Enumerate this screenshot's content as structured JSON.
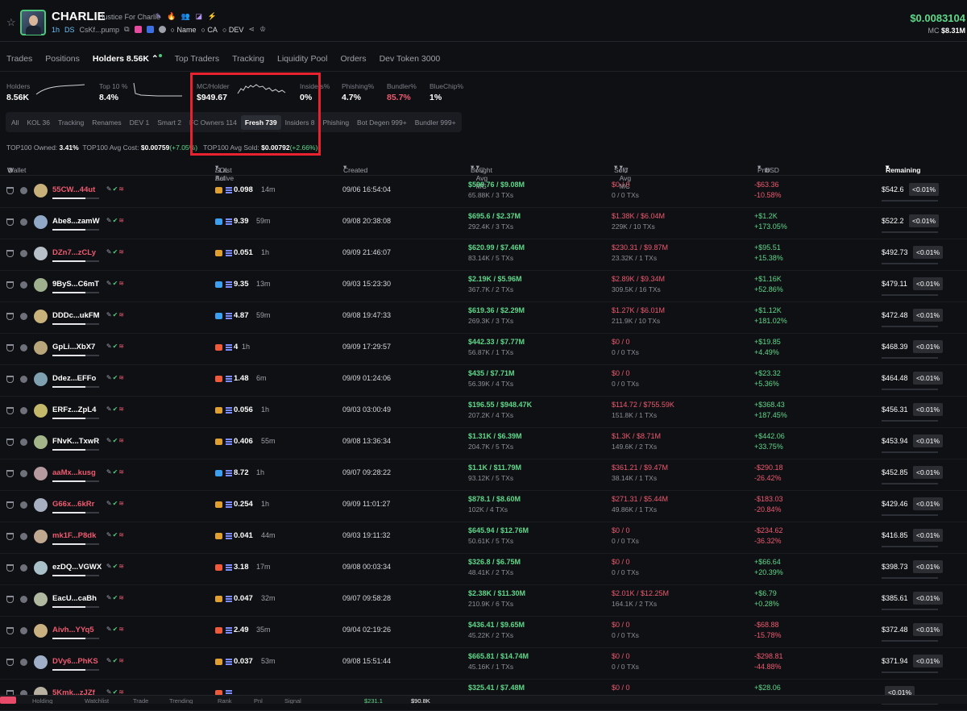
{
  "header": {
    "token_name": "CHARLIE",
    "token_subtitle": "Justice For Charlie",
    "age": "1h",
    "ds": "DS",
    "address": "CsKf...pump",
    "name_label": "Name",
    "ca_label": "CA",
    "dev_label": "DEV",
    "price": "$0.0083104",
    "mc_label": "MC",
    "mc_value": "$8.31M"
  },
  "tabs": [
    "Trades",
    "Positions",
    "Holders 8.56K",
    "Top Traders",
    "Tracking",
    "Liquidity Pool",
    "Orders",
    "Dev Token 3000"
  ],
  "stats": [
    {
      "label": "Holders",
      "value": "8.56K"
    },
    {
      "label": "Top 10 %",
      "value": "8.4%"
    },
    {
      "label": "MC/Holder",
      "value": "$949.67"
    },
    {
      "label": "Insiders%",
      "value": "0%"
    },
    {
      "label": "Phishing%",
      "value": "4.7%"
    },
    {
      "label": "Bundler%",
      "value": "85.7%"
    },
    {
      "label": "BlueChip%",
      "value": "1%"
    }
  ],
  "filters": [
    "All",
    "KOL 36",
    "Tracking",
    "Renames",
    "DEV 1",
    "Smart 2",
    "FC Owners 114",
    "Fresh 739",
    "Insiders 8",
    "Phishing",
    "Bot Degen 999+",
    "Bundler 999+"
  ],
  "top100": {
    "owned_label": "TOP100 Owned:",
    "owned_value": "3.41%",
    "avgcost_label": "TOP100 Avg Cost:",
    "avgcost_value": "$0.00759",
    "avgcost_change": "(+7.05%)",
    "avgsold_label": "TOP100 Avg Sold:",
    "avgsold_value": "$0.00792",
    "avgsold_change": "(+2.66%)"
  },
  "columns": {
    "wallet": "Wallet",
    "sol": "SOL Bal",
    "last_active": "/ Last Active",
    "created": "Created",
    "bought": "Bought",
    "avg_mc_bought": "/ Avg MC",
    "sold": "Sold",
    "avg_mc_sold": "/ Avg MC",
    "pnl": "Pnl",
    "usd": "USD",
    "remaining": "Remaining"
  },
  "rows": [
    {
      "wallet": "55CW...44ut",
      "wcolor": "red",
      "sol": "0.098",
      "active": "14m",
      "solicon": "pump",
      "created": "09/06 16:54:04",
      "bought": "$598.76 / $9.08M",
      "bought_sub": "65.88K / 3 TXs",
      "sold": "$0 / 0",
      "sold_sub": "0 / 0 TXs",
      "pnl": "-$63.36",
      "pnl_pct": "-10.58%",
      "pnl_color": "red",
      "remaining": "$542.6",
      "pct": "<0.01%"
    },
    {
      "wallet": "Abe8...zamW",
      "wcolor": "white",
      "sol": "9.39",
      "active": "59m",
      "solicon": "fish",
      "created": "09/08 20:38:08",
      "bought": "$695.6 / $2.37M",
      "bought_sub": "292.4K / 3 TXs",
      "sold": "$1.38K / $6.04M",
      "sold_sub": "229K / 10 TXs",
      "pnl": "+$1.2K",
      "pnl_pct": "+173.05%",
      "pnl_color": "green",
      "remaining": "$522.2",
      "pct": "<0.01%"
    },
    {
      "wallet": "DZn7...zCLy",
      "wcolor": "red",
      "sol": "0.051",
      "active": "1h",
      "solicon": "pump",
      "created": "09/09 21:46:07",
      "bought": "$620.99 / $7.46M",
      "bought_sub": "83.14K / 5 TXs",
      "sold": "$230.31 / $9.87M",
      "sold_sub": "23.32K / 1 TXs",
      "pnl": "+$95.51",
      "pnl_pct": "+15.38%",
      "pnl_color": "green",
      "remaining": "$492.73",
      "pct": "<0.01%"
    },
    {
      "wallet": "9ByS...C6mT",
      "wcolor": "white",
      "sol": "9.35",
      "active": "13m",
      "solicon": "fish",
      "created": "09/03 15:23:30",
      "bought": "$2.19K / $5.96M",
      "bought_sub": "367.7K / 2 TXs",
      "sold": "$2.89K / $9.34M",
      "sold_sub": "309.5K / 16 TXs",
      "pnl": "+$1.16K",
      "pnl_pct": "+52.86%",
      "pnl_color": "green",
      "remaining": "$479.11",
      "pct": "<0.01%"
    },
    {
      "wallet": "DDDc...ukFM",
      "wcolor": "white",
      "sol": "4.87",
      "active": "59m",
      "solicon": "fish",
      "created": "09/08 19:47:33",
      "bought": "$619.36 / $2.29M",
      "bought_sub": "269.3K / 3 TXs",
      "sold": "$1.27K / $6.01M",
      "sold_sub": "211.9K / 10 TXs",
      "pnl": "+$1.12K",
      "pnl_pct": "+181.02%",
      "pnl_color": "green",
      "remaining": "$472.48",
      "pct": "<0.01%"
    },
    {
      "wallet": "GpLi...XbX7",
      "wcolor": "white",
      "sol": "4",
      "active": "1h",
      "solicon": "shrimp",
      "created": "09/09 17:29:57",
      "bought": "$442.33 / $7.77M",
      "bought_sub": "56.87K / 1 TXs",
      "sold": "$0 / 0",
      "sold_sub": "0 / 0 TXs",
      "pnl": "+$19.85",
      "pnl_pct": "+4.49%",
      "pnl_color": "green",
      "remaining": "$468.39",
      "pct": "<0.01%"
    },
    {
      "wallet": "Ddez...EFFo",
      "wcolor": "white",
      "sol": "1.48",
      "active": "6m",
      "solicon": "shrimp",
      "created": "09/09 01:24:06",
      "bought": "$435 / $7.71M",
      "bought_sub": "56.39K / 4 TXs",
      "sold": "$0 / 0",
      "sold_sub": "0 / 0 TXs",
      "pnl": "+$23.32",
      "pnl_pct": "+5.36%",
      "pnl_color": "green",
      "remaining": "$464.48",
      "pct": "<0.01%"
    },
    {
      "wallet": "ERFz...ZpL4",
      "wcolor": "white",
      "sol": "0.056",
      "active": "1h",
      "solicon": "pump",
      "created": "09/03 03:00:49",
      "bought": "$196.55 / $948.47K",
      "bought_sub": "207.2K / 4 TXs",
      "sold": "$114.72 / $755.59K",
      "sold_sub": "151.8K / 1 TXs",
      "pnl": "+$368.43",
      "pnl_pct": "+187.45%",
      "pnl_color": "green",
      "remaining": "$456.31",
      "pct": "<0.01%"
    },
    {
      "wallet": "FNvK...TxwR",
      "wcolor": "white",
      "sol": "0.406",
      "active": "55m",
      "solicon": "pump",
      "created": "09/08 13:36:34",
      "bought": "$1.31K / $6.39M",
      "bought_sub": "204.7K / 5 TXs",
      "sold": "$1.3K / $8.71M",
      "sold_sub": "149.6K / 2 TXs",
      "pnl": "+$442.06",
      "pnl_pct": "+33.75%",
      "pnl_color": "green",
      "remaining": "$453.94",
      "pct": "<0.01%"
    },
    {
      "wallet": "aaMx...kusg",
      "wcolor": "red",
      "sol": "8.72",
      "active": "1h",
      "solicon": "fish",
      "created": "09/07 09:28:22",
      "bought": "$1.1K / $11.79M",
      "bought_sub": "93.12K / 5 TXs",
      "sold": "$361.21 / $9.47M",
      "sold_sub": "38.14K / 1 TXs",
      "pnl": "-$290.18",
      "pnl_pct": "-26.42%",
      "pnl_color": "red",
      "remaining": "$452.85",
      "pct": "<0.01%"
    },
    {
      "wallet": "G66x...6kRr",
      "wcolor": "red",
      "sol": "0.254",
      "active": "1h",
      "solicon": "pump",
      "created": "09/09 11:01:27",
      "bought": "$878.1 / $8.60M",
      "bought_sub": "102K / 4 TXs",
      "sold": "$271.31 / $5.44M",
      "sold_sub": "49.86K / 1 TXs",
      "pnl": "-$183.03",
      "pnl_pct": "-20.84%",
      "pnl_color": "red",
      "remaining": "$429.46",
      "pct": "<0.01%"
    },
    {
      "wallet": "mk1F...P8dk",
      "wcolor": "red",
      "sol": "0.041",
      "active": "44m",
      "solicon": "pump",
      "created": "09/03 19:11:32",
      "bought": "$645.94 / $12.76M",
      "bought_sub": "50.61K / 5 TXs",
      "sold": "$0 / 0",
      "sold_sub": "0 / 0 TXs",
      "pnl": "-$234.62",
      "pnl_pct": "-36.32%",
      "pnl_color": "red",
      "remaining": "$416.85",
      "pct": "<0.01%"
    },
    {
      "wallet": "ezDQ...VGWX",
      "wcolor": "white",
      "sol": "3.18",
      "active": "17m",
      "solicon": "shrimp",
      "created": "09/08 00:03:34",
      "bought": "$326.8 / $6.75M",
      "bought_sub": "48.41K / 2 TXs",
      "sold": "$0 / 0",
      "sold_sub": "0 / 0 TXs",
      "pnl": "+$66.64",
      "pnl_pct": "+20.39%",
      "pnl_color": "green",
      "remaining": "$398.73",
      "pct": "<0.01%"
    },
    {
      "wallet": "EacU...caBh",
      "wcolor": "white",
      "sol": "0.047",
      "active": "32m",
      "solicon": "pump",
      "created": "09/07 09:58:28",
      "bought": "$2.38K / $11.30M",
      "bought_sub": "210.9K / 6 TXs",
      "sold": "$2.01K / $12.25M",
      "sold_sub": "164.1K / 2 TXs",
      "pnl": "+$6.79",
      "pnl_pct": "+0.28%",
      "pnl_color": "green",
      "remaining": "$385.61",
      "pct": "<0.01%"
    },
    {
      "wallet": "Aivh...YYq5",
      "wcolor": "red",
      "sol": "2.49",
      "active": "35m",
      "solicon": "shrimp",
      "created": "09/04 02:19:26",
      "bought": "$436.41 / $9.65M",
      "bought_sub": "45.22K / 2 TXs",
      "sold": "$0 / 0",
      "sold_sub": "0 / 0 TXs",
      "pnl": "-$68.88",
      "pnl_pct": "-15.78%",
      "pnl_color": "red",
      "remaining": "$372.48",
      "pct": "<0.01%"
    },
    {
      "wallet": "DVy6...PhKS",
      "wcolor": "red",
      "sol": "0.037",
      "active": "53m",
      "solicon": "pump",
      "created": "09/08 15:51:44",
      "bought": "$665.81 / $14.74M",
      "bought_sub": "45.16K / 1 TXs",
      "sold": "$0 / 0",
      "sold_sub": "0 / 0 TXs",
      "pnl": "-$298.81",
      "pnl_pct": "-44.88%",
      "pnl_color": "red",
      "remaining": "$371.94",
      "pct": "<0.01%"
    },
    {
      "wallet": "5Kmk...zJZf",
      "wcolor": "red",
      "sol": "",
      "active": "",
      "solicon": "shrimp",
      "created": "",
      "bought": "$325.41 / $7.48M",
      "bought_sub": "",
      "sold": "$0 / 0",
      "sold_sub": "",
      "pnl": "+$28.06",
      "pnl_pct": "",
      "pnl_color": "green",
      "remaining": "",
      "pct": "<0.01%"
    }
  ],
  "footer": [
    "Holding",
    "Watchlist",
    "Trade",
    "Trending",
    "Rank",
    "Pnl",
    "Signal",
    "$231.1",
    "$90.8K"
  ],
  "colors": {
    "green": "#5fd88a",
    "red": "#ee5a6f",
    "highlight": "#e8232f",
    "background": "#0f1014"
  }
}
